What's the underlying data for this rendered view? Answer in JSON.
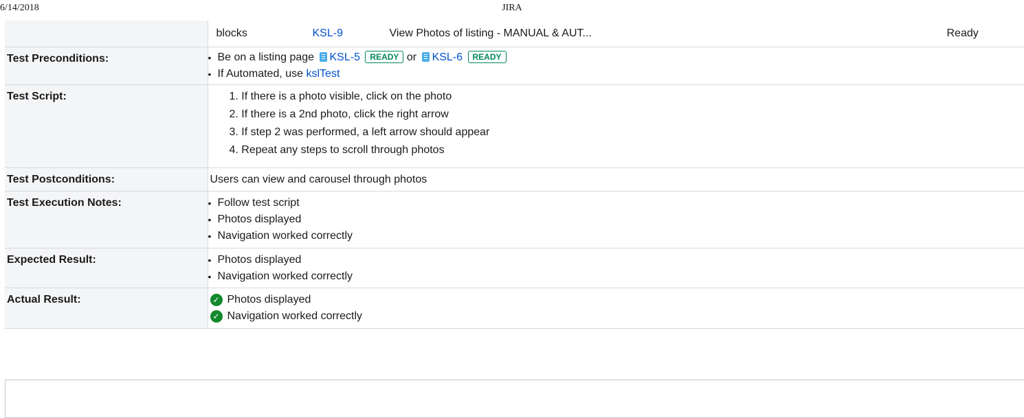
{
  "header": {
    "date": "6/14/2018",
    "title": "JIRA"
  },
  "link": {
    "type": "blocks",
    "key": "KSL-9",
    "summary": "View Photos of listing - MANUAL & AUT...",
    "status": "Ready"
  },
  "preconditions": {
    "label": "Test Preconditions:",
    "line1_prefix": "Be on a listing page",
    "issue1_key": "KSL-5",
    "issue1_status": "READY",
    "line1_or": "or",
    "issue2_key": "KSL-6",
    "issue2_status": "READY",
    "line2_prefix": "If Automated, use",
    "line2_link": "kslTest"
  },
  "script": {
    "label": "Test Script:",
    "steps": [
      "1. If there is a photo visible, click on the photo",
      "2. If there is a 2nd photo, click the right arrow",
      "3. If step 2 was performed, a left arrow should appear",
      "4. Repeat any steps to scroll through photos"
    ]
  },
  "postconditions": {
    "label": "Test Postconditions:",
    "value": "Users can view and carousel through photos"
  },
  "execution_notes": {
    "label": "Test Execution Notes:",
    "items": [
      "Follow test script",
      "Photos displayed",
      "Navigation worked correctly"
    ]
  },
  "expected": {
    "label": "Expected Result:",
    "items": [
      "Photos displayed",
      "Navigation worked correctly"
    ]
  },
  "actual": {
    "label": "Actual Result:",
    "items": [
      "Photos displayed",
      "Navigation worked correctly"
    ]
  },
  "colors": {
    "link": "#0052cc",
    "lozenge_green": "#00875a",
    "check_green": "#14892c",
    "label_bg": "#f4f5f7"
  },
  "icons": {
    "story": "story-icon",
    "check": "check-circle-icon"
  }
}
